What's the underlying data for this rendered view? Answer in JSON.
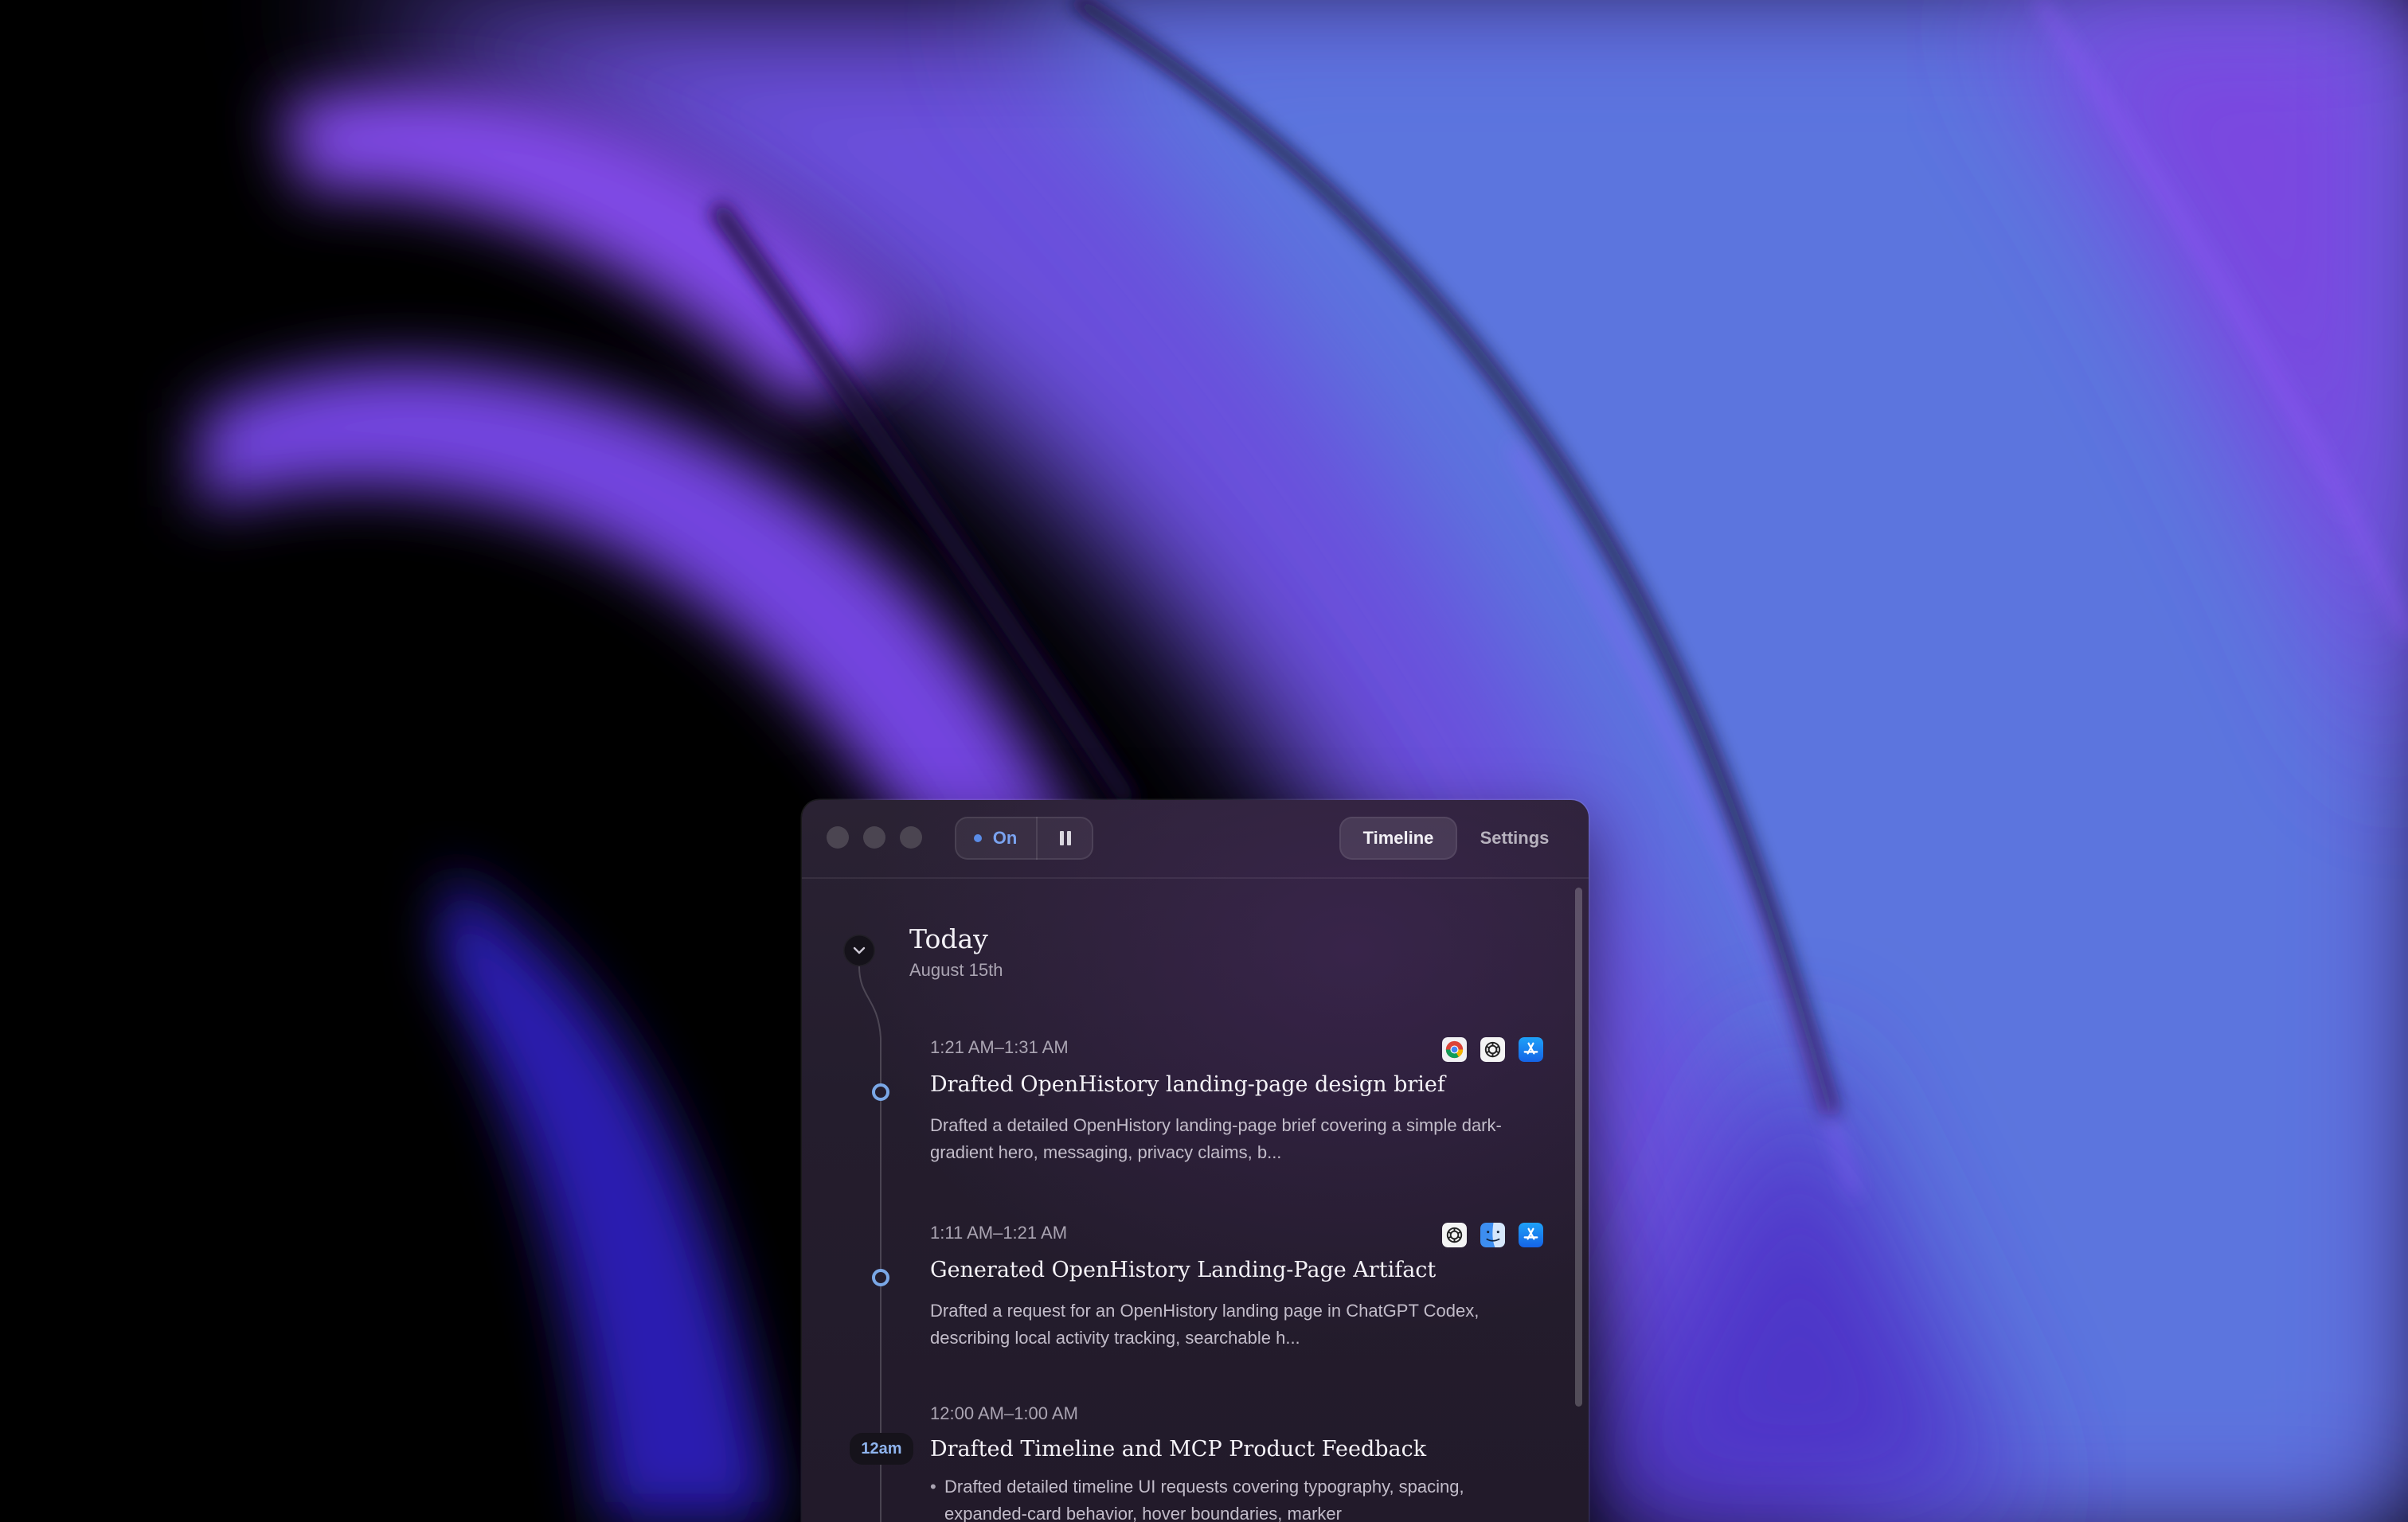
{
  "window": {
    "recorder": {
      "status_label": "On",
      "status_color": "#5a8ce6"
    },
    "tabs": [
      {
        "label": "Timeline",
        "active": true
      },
      {
        "label": "Settings",
        "active": false
      }
    ]
  },
  "timeline": {
    "day": {
      "title": "Today",
      "date": "August 15th"
    },
    "hour_marker": "12am",
    "entries": [
      {
        "time": "1:21 AM–1:31 AM",
        "title": "Drafted OpenHistory landing-page design brief",
        "summary": "Drafted a detailed OpenHistory landing-page brief covering a simple dark-gradient hero, messaging, privacy claims, b...",
        "apps": [
          "chrome-icon",
          "chatgpt-icon",
          "app-store-icon"
        ]
      },
      {
        "time": "1:11 AM–1:21 AM",
        "title": "Generated OpenHistory Landing-Page Artifact",
        "summary": "Drafted a request for an OpenHistory landing page in ChatGPT Codex, describing local activity tracking, searchable h...",
        "apps": [
          "chatgpt-icon",
          "finder-icon",
          "app-store-icon"
        ]
      },
      {
        "time": "12:00 AM–1:00 AM",
        "title": "Drafted Timeline and MCP Product Feedback",
        "summary": "Drafted detailed timeline UI requests covering typography, spacing, expanded-card behavior, hover boundaries, marker"
      }
    ]
  },
  "colors": {
    "accent": "#7aa7e6",
    "window_bg": "#241d2d",
    "wallpaper_violet": "#7a45e6",
    "wallpaper_blue": "#5a78e2"
  }
}
